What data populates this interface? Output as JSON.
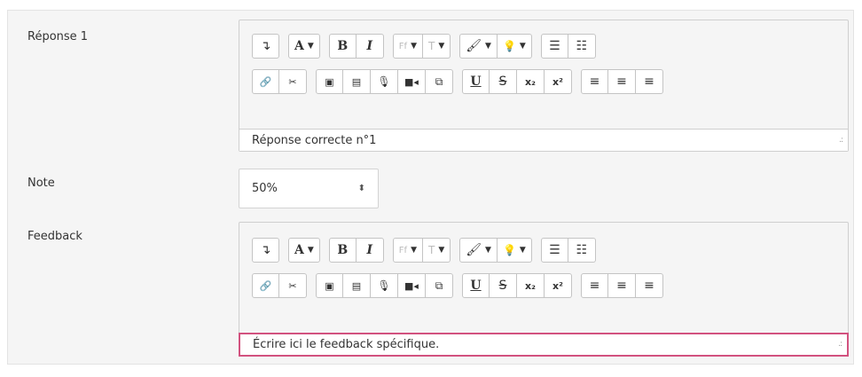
{
  "fields": {
    "reponse_label": "Réponse 1",
    "reponse_value": "Réponse correcte n°1",
    "note_label": "Note",
    "note_value": "50%",
    "feedback_label": "Feedback",
    "feedback_value": "Écrire ici le feedback spécifique."
  },
  "toolbar": {
    "format_icon": "↴",
    "font_a": "A",
    "bold": "B",
    "italic": "I",
    "font_family": "Ff",
    "font_size": "T",
    "underline": "U",
    "strike": "S",
    "subscript": "x₂",
    "superscript": "x²"
  },
  "colors": {
    "focus_border": "#d2527f",
    "panel_bg": "#f5f5f5"
  }
}
